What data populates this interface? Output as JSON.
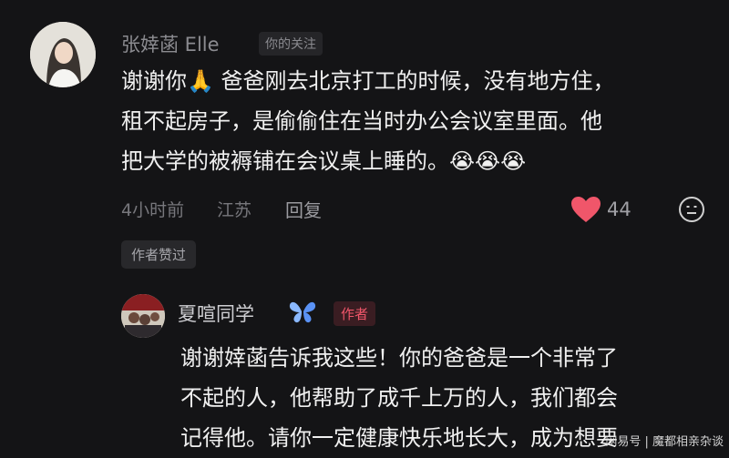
{
  "comment": {
    "author": "张婞菡 Elle",
    "follow_tag": "你的关注",
    "lines": [
      "谢谢你🙏 爸爸刚去北京打工的时候，没有地方住，",
      "租不起房子，是偷偷住在当时办公会议室里面。他",
      "把大学的被褥铺在会议桌上睡的。😭😭😭"
    ],
    "time": "4小时前",
    "location": "江苏",
    "reply_label": "回复",
    "like_count": "44",
    "author_liked": "作者赞过",
    "icons": {
      "like": "heart-icon",
      "emoji": "emoji-icon",
      "prayer": "praying-hands-icon"
    },
    "colors": {
      "like": "#f0566a"
    }
  },
  "reply": {
    "author": "夏喧同学",
    "author_badge": "作者",
    "lines": [
      "谢谢婞菡告诉我这些！你的爸爸是一个非常了",
      "不起的人，他帮助了成千上万的人，我们都会",
      "记得他。请你一定健康快乐地长大，成为想要"
    ],
    "icons": {
      "badge": "butterfly-icon"
    }
  },
  "watermark": "网易号 | 魔都相亲杂谈"
}
